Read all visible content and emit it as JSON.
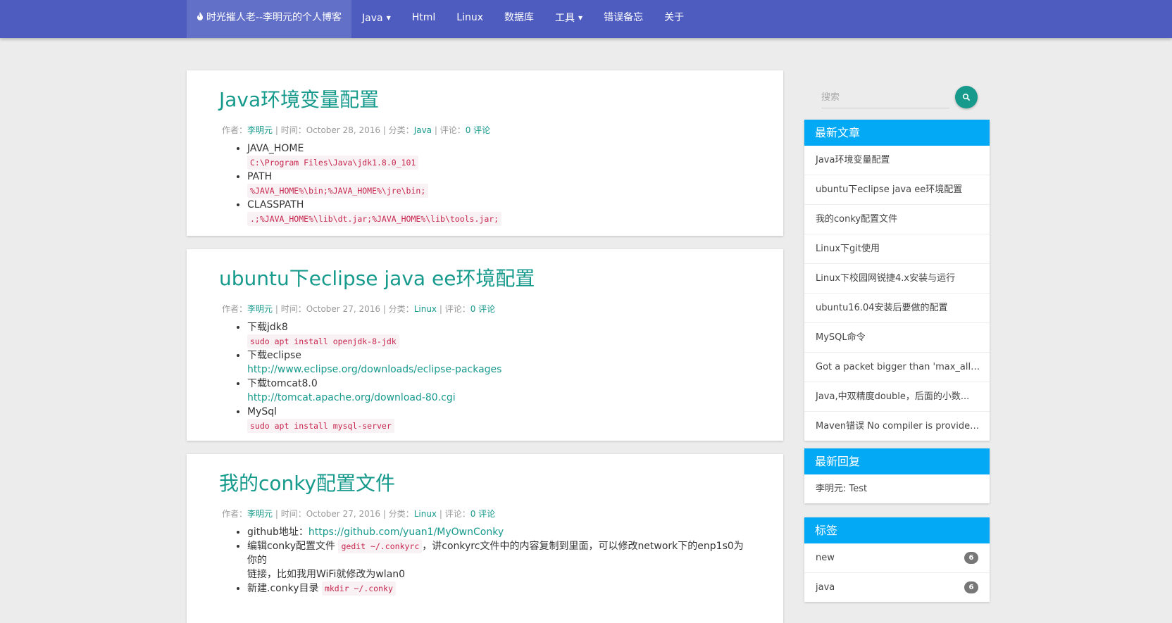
{
  "nav": {
    "brand": "时光摧人老--李明元的个人博客",
    "items": [
      {
        "label": "Java",
        "dropdown": true
      },
      {
        "label": "Html",
        "dropdown": false
      },
      {
        "label": "Linux",
        "dropdown": false
      },
      {
        "label": "数据库",
        "dropdown": false
      },
      {
        "label": "工具",
        "dropdown": true
      },
      {
        "label": "错误备忘",
        "dropdown": false
      },
      {
        "label": "关于",
        "dropdown": false
      }
    ]
  },
  "meta_labels": {
    "author": "作者：",
    "time": " | 时间：",
    "category": " | 分类：",
    "comment": " | 评论：",
    "sep": " "
  },
  "posts": [
    {
      "title": "Java环境变量配置",
      "author": "李明元",
      "date": "October 28, 2016",
      "category": "Java",
      "comments": "0 评论",
      "items": [
        {
          "text": "JAVA_HOME",
          "code": "C:\\Program Files\\Java\\jdk1.8.0_101"
        },
        {
          "text": "PATH",
          "code": "%JAVA_HOME%\\bin;%JAVA_HOME%\\jre\\bin;"
        },
        {
          "text": "CLASSPATH",
          "code": ".;%JAVA_HOME%\\lib\\dt.jar;%JAVA_HOME%\\lib\\tools.jar;"
        }
      ]
    },
    {
      "title": "ubuntu下eclipse java ee环境配置",
      "author": "李明元",
      "date": "October 27, 2016",
      "category": "Linux",
      "comments": "0 评论",
      "items": [
        {
          "text": "下载jdk8",
          "code": "sudo apt install openjdk-8-jdk"
        },
        {
          "text": "下载eclipse",
          "link": "http://www.eclipse.org/downloads/eclipse-packages"
        },
        {
          "text": "下载tomcat8.0",
          "link": "http://tomcat.apache.org/download-80.cgi"
        },
        {
          "text": "MySql",
          "code": "sudo apt install mysql-server"
        }
      ]
    },
    {
      "title": "我的conky配置文件",
      "author": "李明元",
      "date": "October 27, 2016",
      "category": "Linux",
      "comments": "0 评论",
      "items": [
        {
          "text": "github地址：",
          "link": "https://github.com/yuan1/MyOwnConky"
        },
        {
          "text": "编辑conky配置文件 ",
          "code": "gedit ~/.conkyrc",
          "after": "，讲conkyrc文件中的内容复制到里面，可以修改network下的enp1s0为你的",
          "line2": "链接，比如我用WiFi就修改为wlan0"
        },
        {
          "text": "新建.conky目录 ",
          "code": "mkdir ~/.conky"
        }
      ]
    }
  ],
  "search": {
    "placeholder": "搜索"
  },
  "recent_posts": {
    "title": "最新文章",
    "items": [
      "Java环境变量配置",
      "ubuntu下eclipse java ee环境配置",
      "我的conky配置文件",
      "Linux下git使用",
      "Linux下校园网锐捷4.x安装与运行",
      "ubuntu16.04安装后要做的配置",
      "MySQL命令",
      "Got a packet bigger than 'max_allow...",
      "Java,中双精度double，后面的小数...",
      "Maven错误 No compiler is provided..."
    ]
  },
  "recent_replies": {
    "title": "最新回复",
    "items": [
      "李明元: Test"
    ]
  },
  "tags": {
    "title": "标签",
    "items": [
      {
        "name": "new",
        "count": "6"
      },
      {
        "name": "java",
        "count": "6"
      }
    ]
  },
  "colors": {
    "nav": "#4e5cbf",
    "accent": "#169a8c",
    "panel_header": "#03a9f4",
    "code": "#c7254e"
  }
}
